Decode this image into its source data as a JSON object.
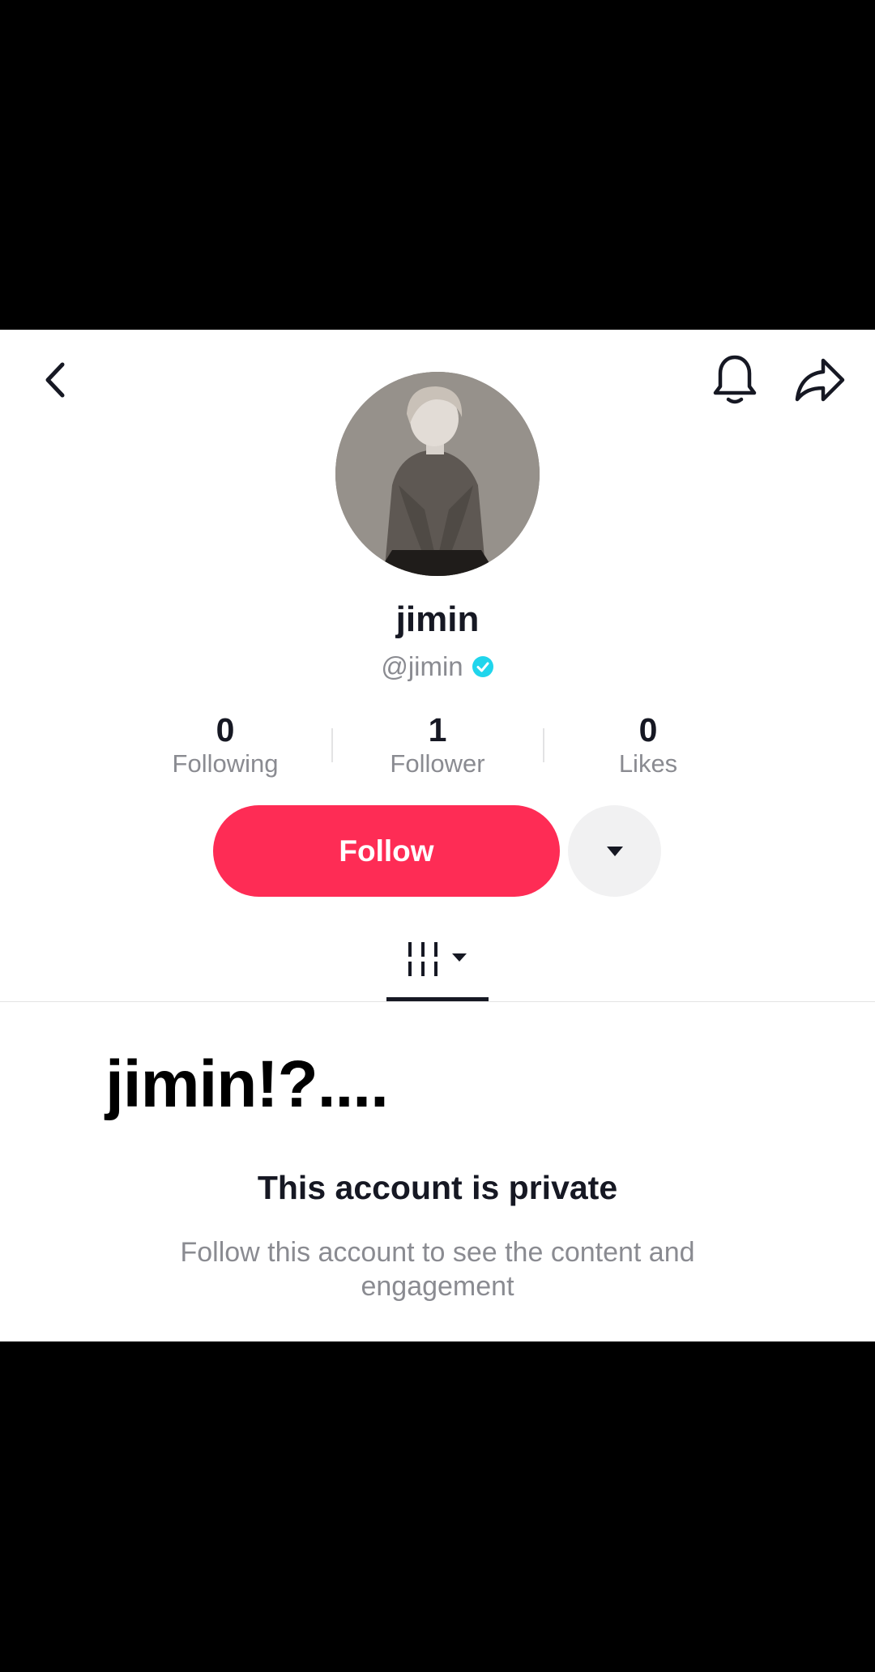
{
  "profile": {
    "display_name": "jimin",
    "handle": "@jimin",
    "verified": true,
    "verified_color": "#20d5ec"
  },
  "stats": [
    {
      "value": "0",
      "label": "Following"
    },
    {
      "value": "1",
      "label": "Follower"
    },
    {
      "value": "0",
      "label": "Likes"
    }
  ],
  "actions": {
    "follow_label": "Follow",
    "follow_color": "#fe2c55"
  },
  "nav_icons": [
    "back-chevron-icon",
    "bell-icon",
    "share-arrow-icon"
  ],
  "tabs": {
    "active_icon": "videos-grid-icon"
  },
  "bio": "jimin!?....",
  "private_notice": {
    "title": "This account is private",
    "description": "Follow this account to see the content and engagement"
  }
}
